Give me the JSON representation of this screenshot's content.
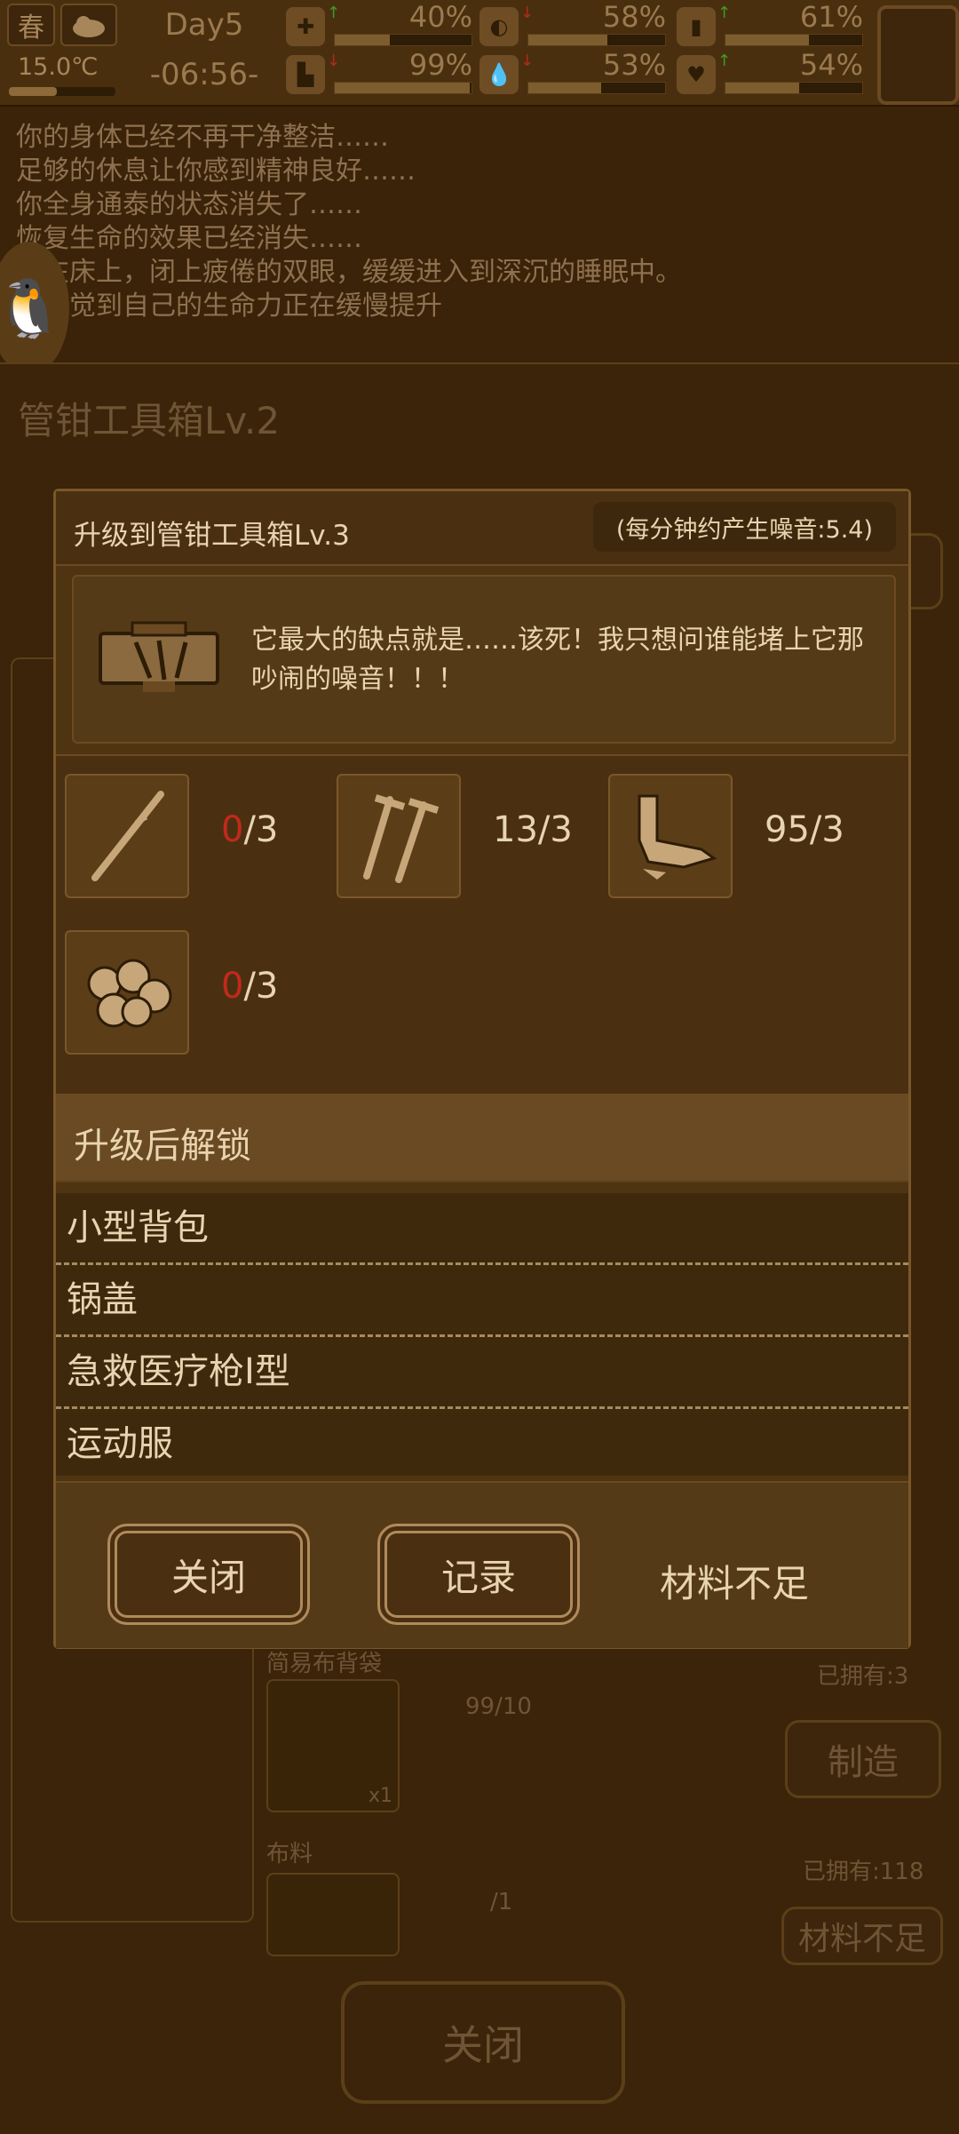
{
  "top": {
    "season": "春",
    "temperature": "15.0℃",
    "day": "Day5",
    "time": "-06:56-",
    "stats": [
      {
        "name": "health-kit",
        "value": "40%",
        "fill": 0.4,
        "trend": "up"
      },
      {
        "name": "stomach",
        "value": "58%",
        "fill": 0.58,
        "trend": "down"
      },
      {
        "name": "bottle",
        "value": "61%",
        "fill": 0.61,
        "trend": "up"
      },
      {
        "name": "boot",
        "value": "99%",
        "fill": 0.99,
        "trend": "down"
      },
      {
        "name": "water-drop",
        "value": "53%",
        "fill": 0.53,
        "trend": "down"
      },
      {
        "name": "heart",
        "value": "54%",
        "fill": 0.54,
        "trend": "up"
      }
    ]
  },
  "log": [
    "你的身体已经不再干净整洁……",
    "足够的休息让你感到精神良好……",
    "你全身通泰的状态消失了……",
    "恢复生命的效果已经消失……",
    "躺在床上，闭上疲倦的双眼，缓缓进入到深沉的睡眠中。",
    "你感觉到自己的生命力正在缓慢提升"
  ],
  "background": {
    "title": "管钳工具箱Lv.2",
    "items": [
      {
        "label": "简易布背袋",
        "owned": "已拥有:3",
        "count": "99/10",
        "qty": "x1",
        "button": "制造"
      },
      {
        "label": "布料",
        "owned": "已拥有:118",
        "count": "/1",
        "button": "材料不足"
      }
    ],
    "close": "关闭"
  },
  "dialog": {
    "title": "升级到管钳工具箱Lv.3",
    "noise": "(每分钟约产生噪音:5.4)",
    "description": "它最大的缺点就是……该死！我只想问谁能堵上它那吵闹的噪音！！！",
    "materials": [
      {
        "icon": "stick-icon",
        "have": "0",
        "need": "/3",
        "short": true
      },
      {
        "icon": "nails-icon",
        "have": "13",
        "need": "/3",
        "short": false
      },
      {
        "icon": "scrap-metal-icon",
        "have": "95",
        "need": "/3",
        "short": false
      },
      {
        "icon": "stones-icon",
        "have": "0",
        "need": "/3",
        "short": true
      }
    ],
    "unlock_heading": "升级后解锁",
    "unlocks": [
      "小型背包",
      "锅盖",
      "急救医疗枪I型",
      "运动服"
    ],
    "buttons": {
      "close": "关闭",
      "record": "记录"
    },
    "status": "材料不足"
  },
  "colors": {
    "accent": "#e9d4b1",
    "short": "#c2291c",
    "panel": "#4f3412"
  }
}
